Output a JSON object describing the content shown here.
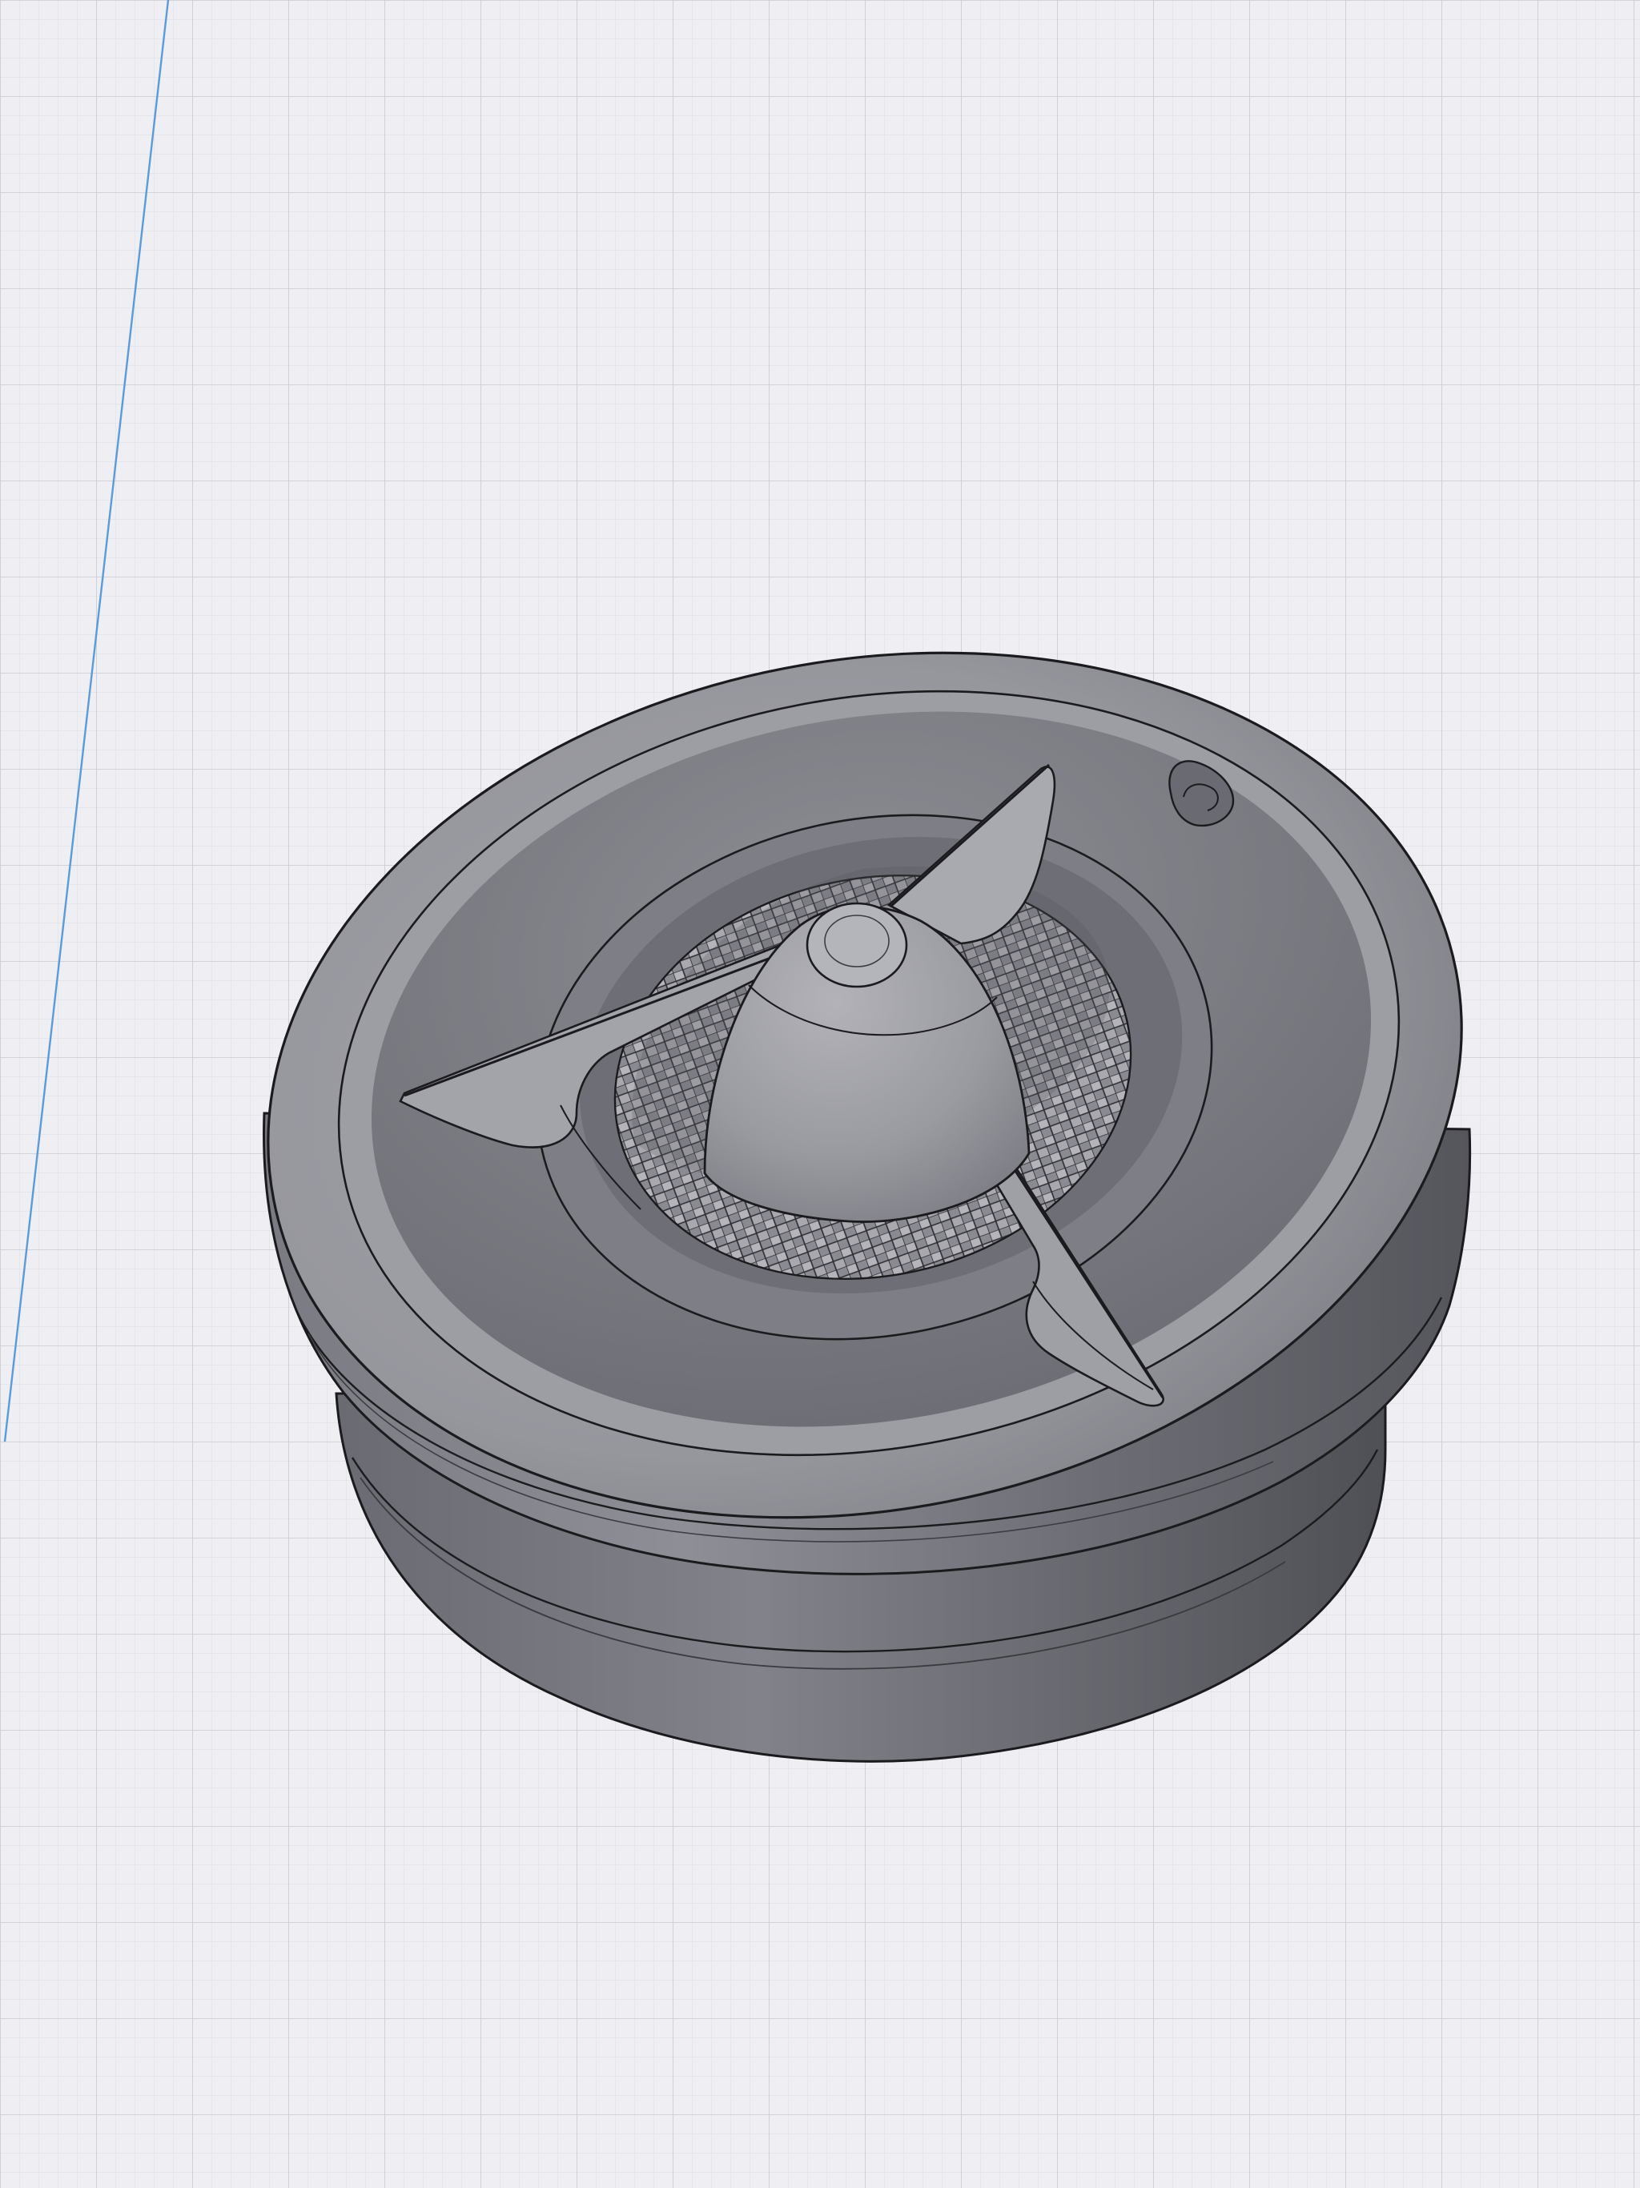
{
  "app": {
    "view": "3d-model-viewport"
  },
  "scene": {
    "background_color": "#eeeef3",
    "grid_minor_color": "#dcdce4",
    "grid_major_color": "#c8c8d2",
    "axis_color": "#5b9bd8",
    "model_colors": {
      "body_dark": "#5e5e66",
      "body_mid": "#7c7c84",
      "body_light": "#a4a4ab",
      "top_face": "#9a9aa1",
      "edge": "#1b1b1f"
    },
    "objects": [
      {
        "name": "cylindrical-housing",
        "icon": "cylinder-model-icon"
      },
      {
        "name": "propeller-blades",
        "icon": "propeller-icon"
      },
      {
        "name": "center-hub-dome",
        "icon": "dome-icon"
      },
      {
        "name": "mesh-grille",
        "icon": "grid-mesh-icon"
      },
      {
        "name": "rim-notch",
        "icon": "notch-icon"
      }
    ]
  }
}
